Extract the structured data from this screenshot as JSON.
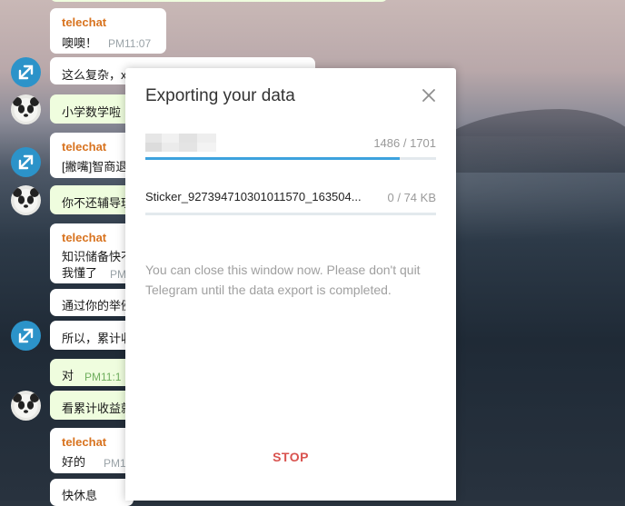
{
  "chat": {
    "messages": [
      {
        "sender": "telechat",
        "text": "噢噢！",
        "time": "PM11:07"
      },
      {
        "text": "这么复杂，x"
      },
      {
        "text": "小学数学啦"
      },
      {
        "sender": "telechat",
        "text": "[撇嘴]智商退"
      },
      {
        "text": "你不还辅导玩"
      },
      {
        "sender": "telechat",
        "text": "知识储备快不",
        "text2": "我懂了",
        "time": "PM"
      },
      {
        "text": "通过你的举例"
      },
      {
        "text": "所以，累计收"
      },
      {
        "text": "对",
        "time": "PM11:1"
      },
      {
        "text": "看累计收益就"
      },
      {
        "sender": "telechat",
        "text": "好的",
        "time": "PM1"
      },
      {
        "text": "快休息"
      }
    ]
  },
  "dialog": {
    "title": "Exporting your data",
    "progress_count": "1486 / 1701",
    "progress_fraction": 0.874,
    "current_file": "Sticker_927394710301011570_163504...",
    "current_size": "0 / 74 KB",
    "file_progress_fraction": 0.0,
    "note": "You can close this window now. Please don't quit Telegram until the data export is completed.",
    "stop_label": "STOP"
  }
}
